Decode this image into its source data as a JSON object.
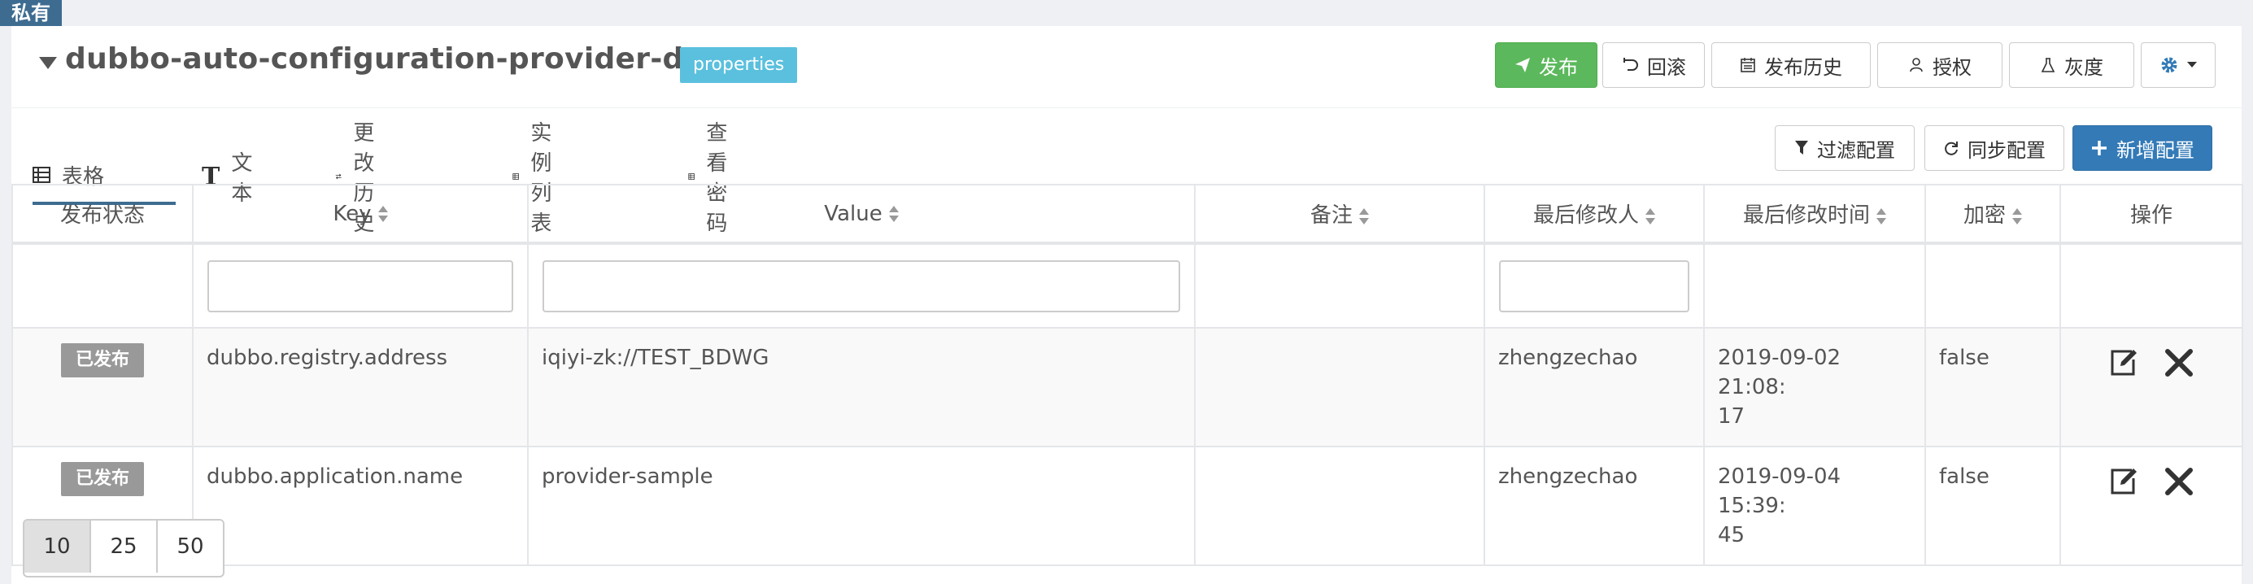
{
  "private_tag": "私有",
  "namespace": {
    "title": "dubbo-auto-configuration-provider-demo",
    "format": "properties"
  },
  "actions": {
    "publish": "发布",
    "rollback": "回滚",
    "history": "发布历史",
    "authorize": "授权",
    "gray": "灰度"
  },
  "tabs": [
    "表格",
    "文本",
    "更改历史",
    "实例列表",
    "查看密码"
  ],
  "toolbar": {
    "filter": "过滤配置",
    "sync": "同步配置",
    "add": "新增配置"
  },
  "table": {
    "headers": [
      "发布状态",
      "Key",
      "Value",
      "备注",
      "最后修改人",
      "最后修改时间",
      "加密",
      "操作"
    ],
    "rows": [
      {
        "status": "已发布",
        "key": "dubbo.registry.address",
        "value": "iqiyi-zk://TEST_BDWG",
        "comment": "",
        "modifier": "zhengzechao",
        "time_line1": "2019-09-02 21:08:",
        "time_line2": "17",
        "encrypted": "false"
      },
      {
        "status": "已发布",
        "key": "dubbo.application.name",
        "value": "provider-sample",
        "comment": "",
        "modifier": "zhengzechao",
        "time_line1": "2019-09-04 15:39:",
        "time_line2": "45",
        "encrypted": "false"
      }
    ]
  },
  "pagination": [
    "10",
    "25",
    "50"
  ],
  "colors": {
    "primary": "#337ab7",
    "success": "#5cb85c",
    "info": "#5bc0de",
    "tag": "#3e6c91"
  }
}
